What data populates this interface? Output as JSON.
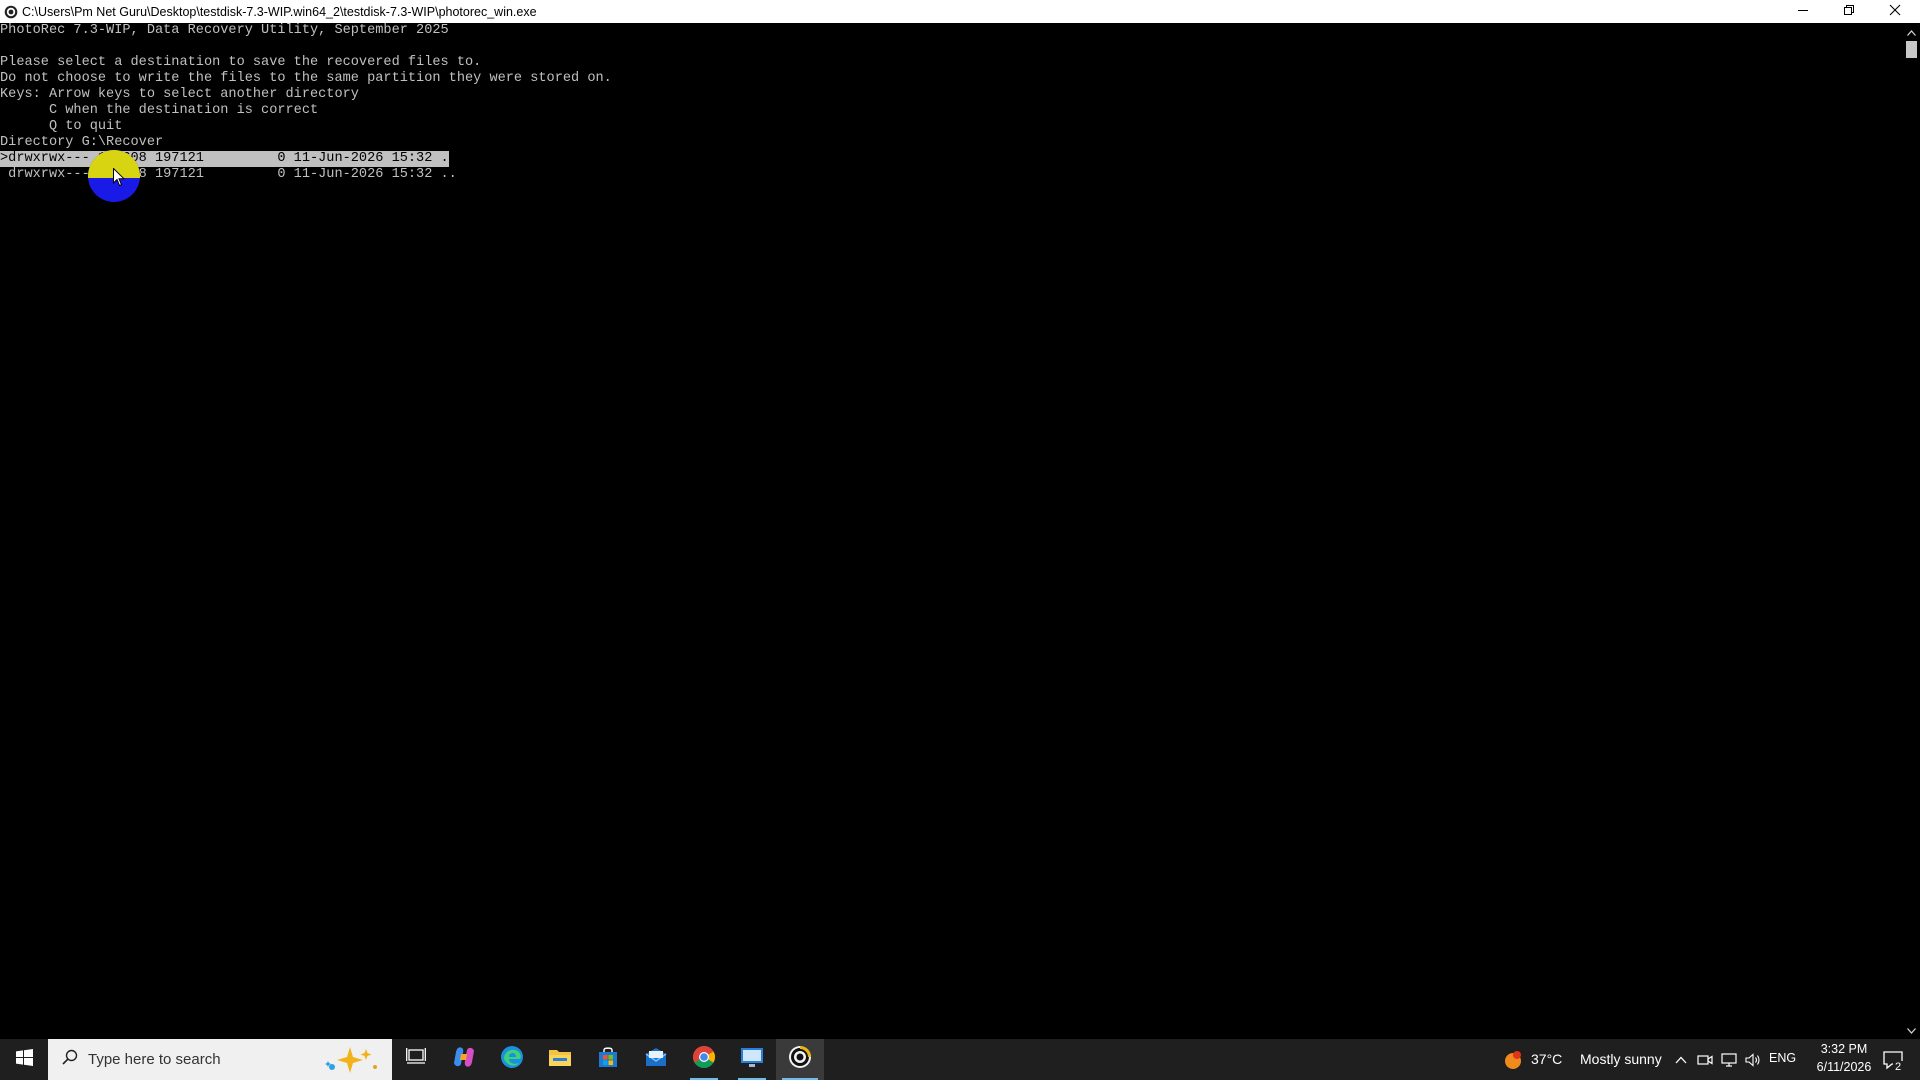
{
  "window": {
    "title": "C:\\Users\\Pm Net Guru\\Desktop\\testdisk-7.3-WIP.win64_2\\testdisk-7.3-WIP\\photorec_win.exe",
    "icons": [
      "photorec-icon",
      "minimize-icon",
      "restore-icon",
      "close-icon"
    ]
  },
  "console": {
    "lines": [
      "PhotoRec 7.3-WIP, Data Recovery Utility, September 2025",
      "",
      "Please select a destination to save the recovered files to.",
      "Do not choose to write the files to the same partition they were stored on.",
      "Keys: Arrow keys to select another directory",
      "      C when the destination is correct",
      "      Q to quit",
      "Directory G:\\Recover"
    ],
    "entries": [
      {
        "text": ">drwxrwx--- 197608 197121         0 11-Jun-2026 15:32 .",
        "selected": true
      },
      {
        "text": " drwxrwx--- 197608 197121         0 11-Jun-2026 15:32 ..",
        "selected": false
      }
    ]
  },
  "taskbar": {
    "search_placeholder": "Type here to search",
    "weather_temp": "37°C",
    "weather_desc": "Mostly sunny",
    "language": "ENG",
    "time": "3:32 PM",
    "date": "6/11/2026",
    "notification_count": "2",
    "pinned": [
      "task-view",
      "copilot",
      "edge",
      "file-explorer",
      "store",
      "mail",
      "chrome",
      "remote-desktop",
      "photorec"
    ]
  },
  "colors": {
    "console_bg": "#000000",
    "console_fg": "#c0c0c0",
    "taskbar_bg": "#1f1f1f",
    "cursor_halo": "#1a1ae6",
    "cursor_halo_top": "#e8e400"
  }
}
